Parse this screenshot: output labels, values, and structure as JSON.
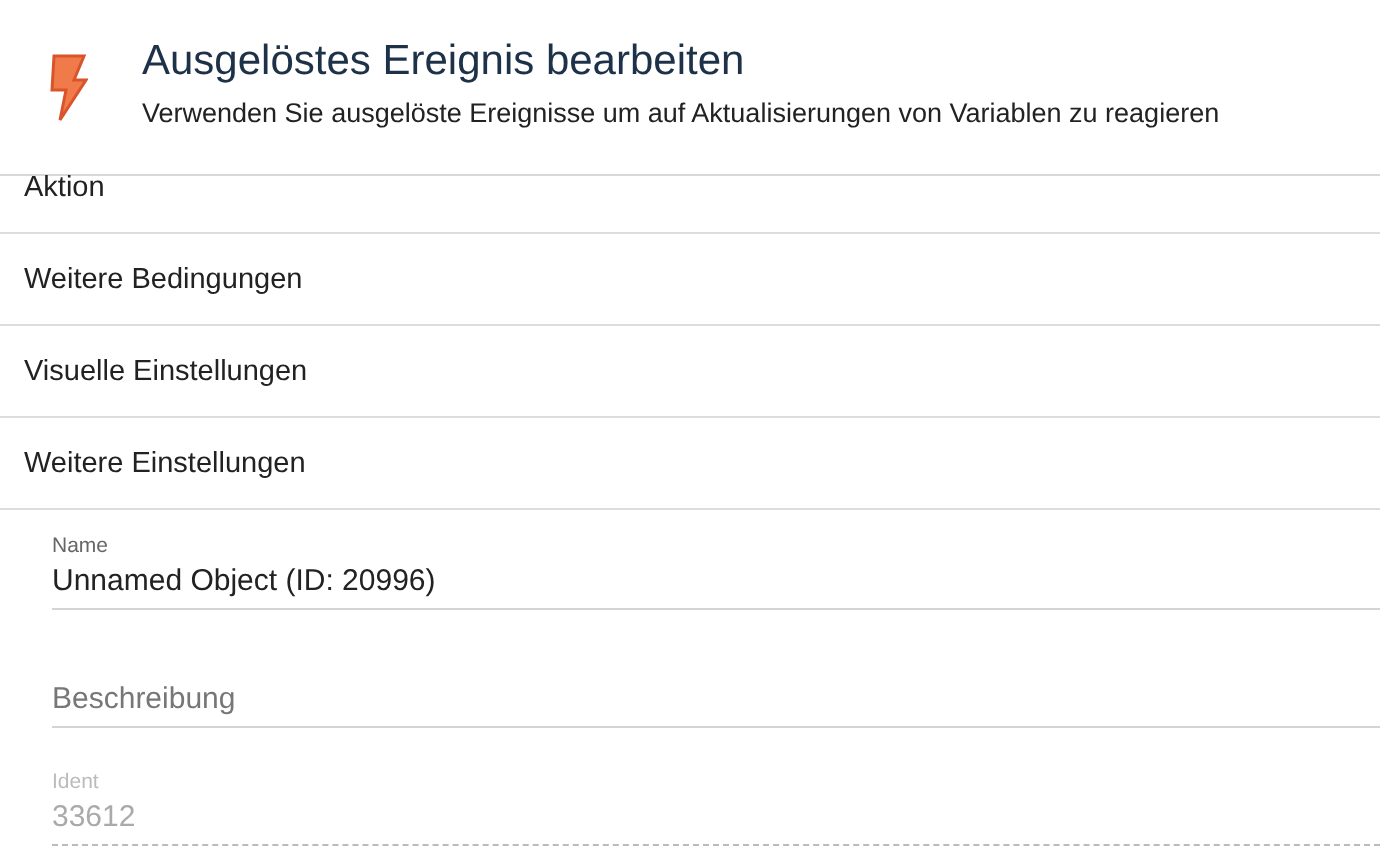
{
  "header": {
    "title": "Ausgelöstes Ereignis bearbeiten",
    "subtitle": "Verwenden Sie ausgelöste Ereignisse um auf Aktualisierungen von Variablen zu reagieren"
  },
  "sections": [
    {
      "label": "Aktion",
      "cut": true
    },
    {
      "label": "Weitere Bedingungen",
      "cut": false
    },
    {
      "label": "Visuelle Einstellungen",
      "cut": false
    },
    {
      "label": "Weitere Einstellungen",
      "cut": false
    }
  ],
  "fields": [
    {
      "label": "Name",
      "value": "Unnamed Object (ID: 20996)",
      "disabled": false
    },
    {
      "placeholder": "Beschreibung",
      "disabled": false
    },
    {
      "label": "Ident",
      "value": "33612",
      "disabled": true
    }
  ]
}
